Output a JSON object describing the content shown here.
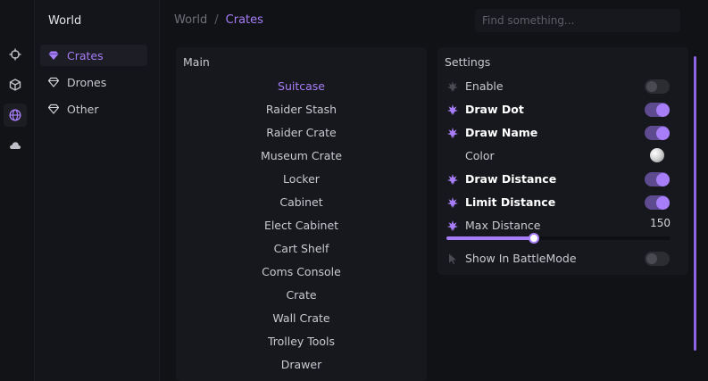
{
  "accent_color": "#a77ef7",
  "rail": {
    "items": [
      {
        "icon": "crosshair-icon",
        "active": false
      },
      {
        "icon": "cube-icon",
        "active": false
      },
      {
        "icon": "globe-icon",
        "active": true
      },
      {
        "icon": "cloud-icon",
        "active": false
      }
    ]
  },
  "sidebar": {
    "title": "World",
    "items": [
      {
        "label": "Crates",
        "icon": "gem-icon",
        "active": true
      },
      {
        "label": "Drones",
        "icon": "gem-icon",
        "active": false
      },
      {
        "label": "Other",
        "icon": "gem-icon",
        "active": false
      }
    ]
  },
  "header": {
    "breadcrumb": {
      "root": "World",
      "separator": "/",
      "current": "Crates"
    },
    "search_placeholder": "Find something..."
  },
  "main": {
    "title": "Main",
    "items": [
      {
        "label": "Suitcase",
        "active": true
      },
      {
        "label": "Raider Stash",
        "active": false
      },
      {
        "label": "Raider Crate",
        "active": false
      },
      {
        "label": "Museum Crate",
        "active": false
      },
      {
        "label": "Locker",
        "active": false
      },
      {
        "label": "Cabinet",
        "active": false
      },
      {
        "label": "Elect Cabinet",
        "active": false
      },
      {
        "label": "Cart Shelf",
        "active": false
      },
      {
        "label": "Coms Console",
        "active": false
      },
      {
        "label": "Crate",
        "active": false
      },
      {
        "label": "Wall Crate",
        "active": false
      },
      {
        "label": "Trolley Tools",
        "active": false
      },
      {
        "label": "Drawer",
        "active": false
      }
    ]
  },
  "settings": {
    "title": "Settings",
    "enable": {
      "label": "Enable",
      "on": false,
      "icon": "leaf-icon"
    },
    "draw_dot": {
      "label": "Draw Dot",
      "on": true,
      "icon": "leaf-icon"
    },
    "draw_name": {
      "label": "Draw Name",
      "on": true,
      "icon": "leaf-icon"
    },
    "color": {
      "label": "Color",
      "value": "#e0e0e0"
    },
    "draw_distance": {
      "label": "Draw Distance",
      "on": true,
      "icon": "leaf-icon"
    },
    "limit_distance": {
      "label": "Limit Distance",
      "on": true,
      "icon": "leaf-icon"
    },
    "max_distance": {
      "label": "Max Distance",
      "value": "150",
      "fraction": 0.39,
      "icon": "leaf-icon"
    },
    "show_in_battlemode": {
      "label": "Show In BattleMode",
      "on": false,
      "icon": "cursor-icon"
    }
  }
}
